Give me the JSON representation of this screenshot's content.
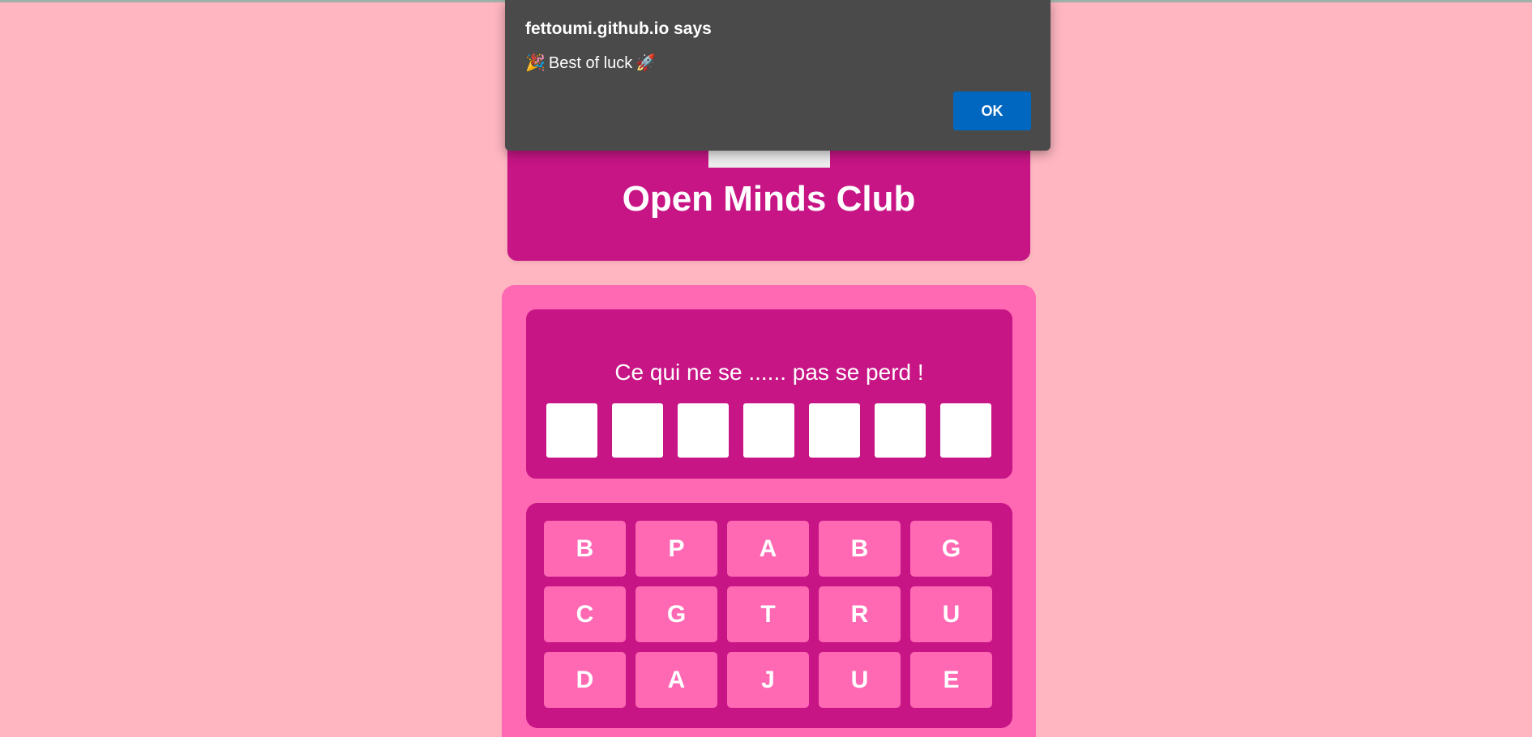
{
  "dialog": {
    "title": "fettoumi.github.io says",
    "message_emoji_start": "🎉",
    "message_text": "Best of luck",
    "message_emoji_end": "🚀",
    "ok_label": "OK"
  },
  "header": {
    "title": "Open Minds Club"
  },
  "puzzle": {
    "clue": "Ce qui ne se ...... pas se perd !",
    "answer_slots": [
      "",
      "",
      "",
      "",
      "",
      "",
      ""
    ]
  },
  "letters": [
    "B",
    "P",
    "A",
    "B",
    "G",
    "C",
    "G",
    "T",
    "R",
    "U",
    "D",
    "A",
    "J",
    "U",
    "E"
  ],
  "colors": {
    "page_background": "#ffb6c1",
    "primary": "#c71585",
    "secondary": "#ff69b4",
    "dialog_background": "#4a4a4a",
    "dialog_button": "#0067c0"
  }
}
